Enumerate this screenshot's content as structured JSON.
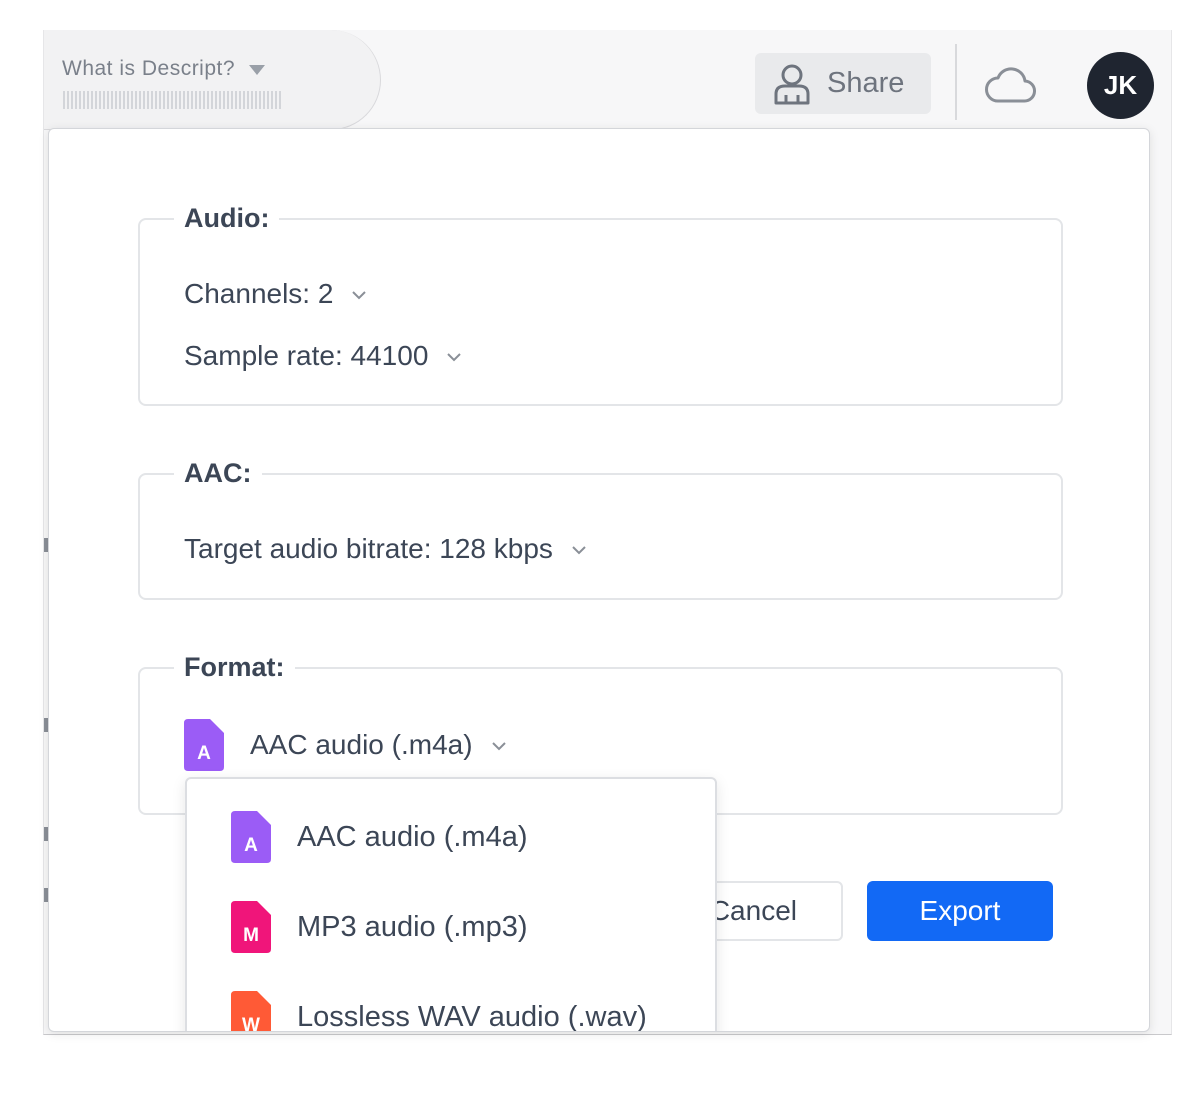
{
  "header": {
    "doc_title": "What is Descript?",
    "share_label": "Share",
    "avatar_initials": "JK"
  },
  "dialog": {
    "audio": {
      "legend": "Audio:",
      "channels": "Channels: 2",
      "sample_rate": "Sample rate: 44100"
    },
    "aac": {
      "legend": "AAC:",
      "bitrate": "Target audio bitrate: 128 kbps"
    },
    "format": {
      "legend": "Format:",
      "selected_label": "AAC audio (.m4a)",
      "selected_badge": "A"
    },
    "format_options": [
      {
        "label": "AAC audio (.m4a)",
        "badge": "A",
        "color": "#9b5cf6"
      },
      {
        "label": "MP3 audio (.mp3)",
        "badge": "M",
        "color": "#f0157a"
      },
      {
        "label": "Lossless WAV audio (.wav)",
        "badge": "W",
        "color": "#ff5a36"
      }
    ],
    "cancel_label": "Cancel",
    "export_label": "Export"
  },
  "colors": {
    "accent": "#1269f5",
    "text": "#3c4656",
    "aac_badge": "#9b5cf6",
    "mp3_badge": "#f0157a",
    "wav_badge": "#ff5a36"
  }
}
